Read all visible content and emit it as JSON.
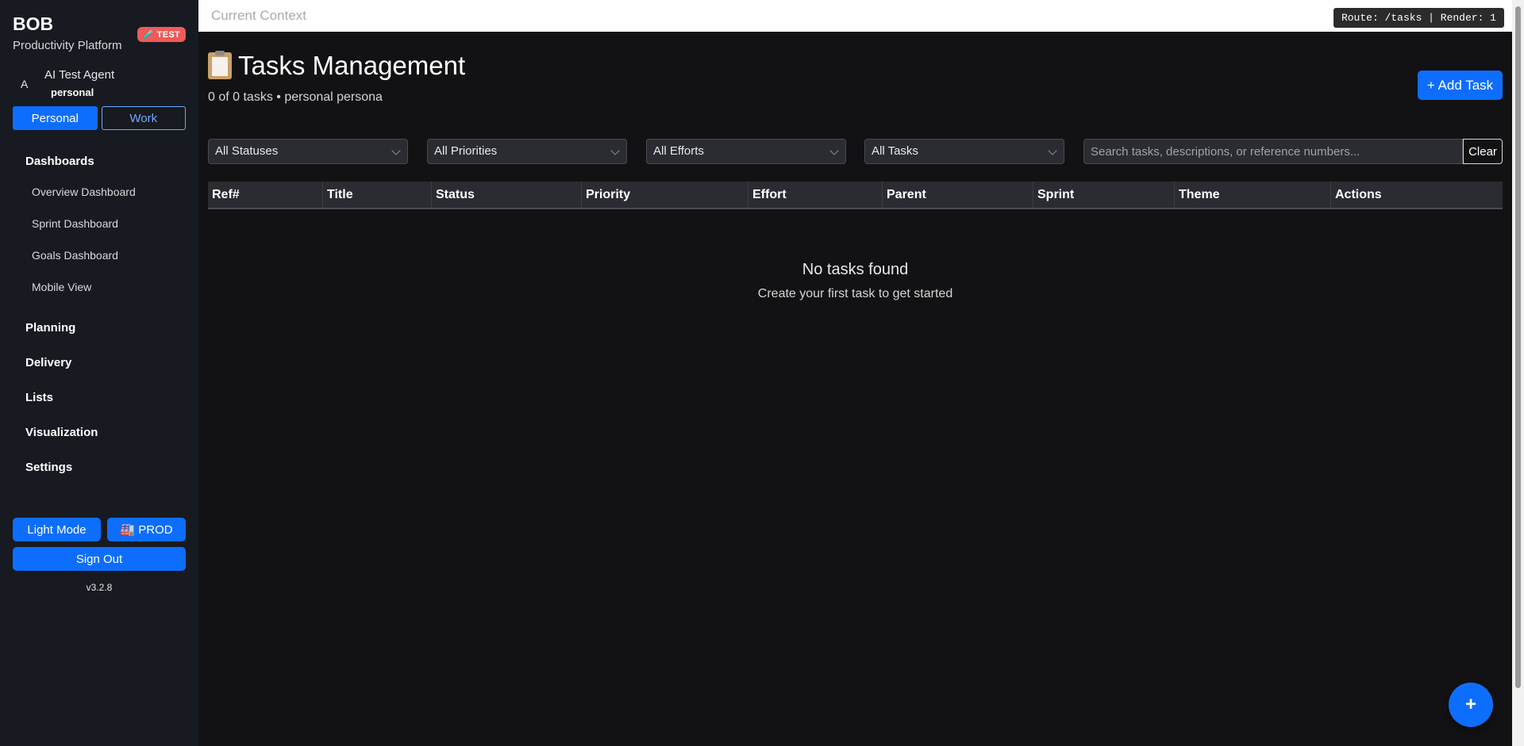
{
  "sidebar": {
    "brand_title": "BOB",
    "brand_subtitle": "Productivity Platform",
    "test_badge": "🧪 TEST",
    "user_avatar": "A",
    "user_name": "AI Test Agent",
    "user_persona": "personal",
    "persona_personal": "Personal",
    "persona_work": "Work",
    "nav": {
      "dashboards": "Dashboards",
      "sub_items": [
        "Overview Dashboard",
        "Sprint Dashboard",
        "Goals Dashboard",
        "Mobile View"
      ],
      "planning": "Planning",
      "delivery": "Delivery",
      "lists": "Lists",
      "visualization": "Visualization",
      "settings": "Settings"
    },
    "light_mode_label": "Light Mode",
    "prod_label": "🏭 PROD",
    "sign_out_label": "Sign Out",
    "version": "v3.2.8"
  },
  "topbar": {
    "context_label": "Current Context",
    "route_badge": "Route: /tasks | Render: 1"
  },
  "main": {
    "title": "Tasks Management",
    "subtitle": "0 of 0 tasks • personal persona",
    "add_task_label": "+ Add Task",
    "filters": {
      "status": "All Statuses",
      "priority": "All Priorities",
      "effort": "All Efforts",
      "tasks": "All Tasks",
      "search_placeholder": "Search tasks, descriptions, or reference numbers...",
      "clear_label": "Clear"
    },
    "columns": [
      "Ref#",
      "Title",
      "Status",
      "Priority",
      "Effort",
      "Parent",
      "Sprint",
      "Theme",
      "Actions"
    ],
    "empty_title": "No tasks found",
    "empty_subtitle": "Create your first task to get started",
    "fab_label": "+"
  },
  "icons": {
    "page_title_icon": "clipboard-icon",
    "select_icon": "chevron-down-icon"
  },
  "colors": {
    "accent": "#0d6efd",
    "background": "#121214",
    "sidebar": "#181a21",
    "test_badge": "#ef5a5a"
  }
}
